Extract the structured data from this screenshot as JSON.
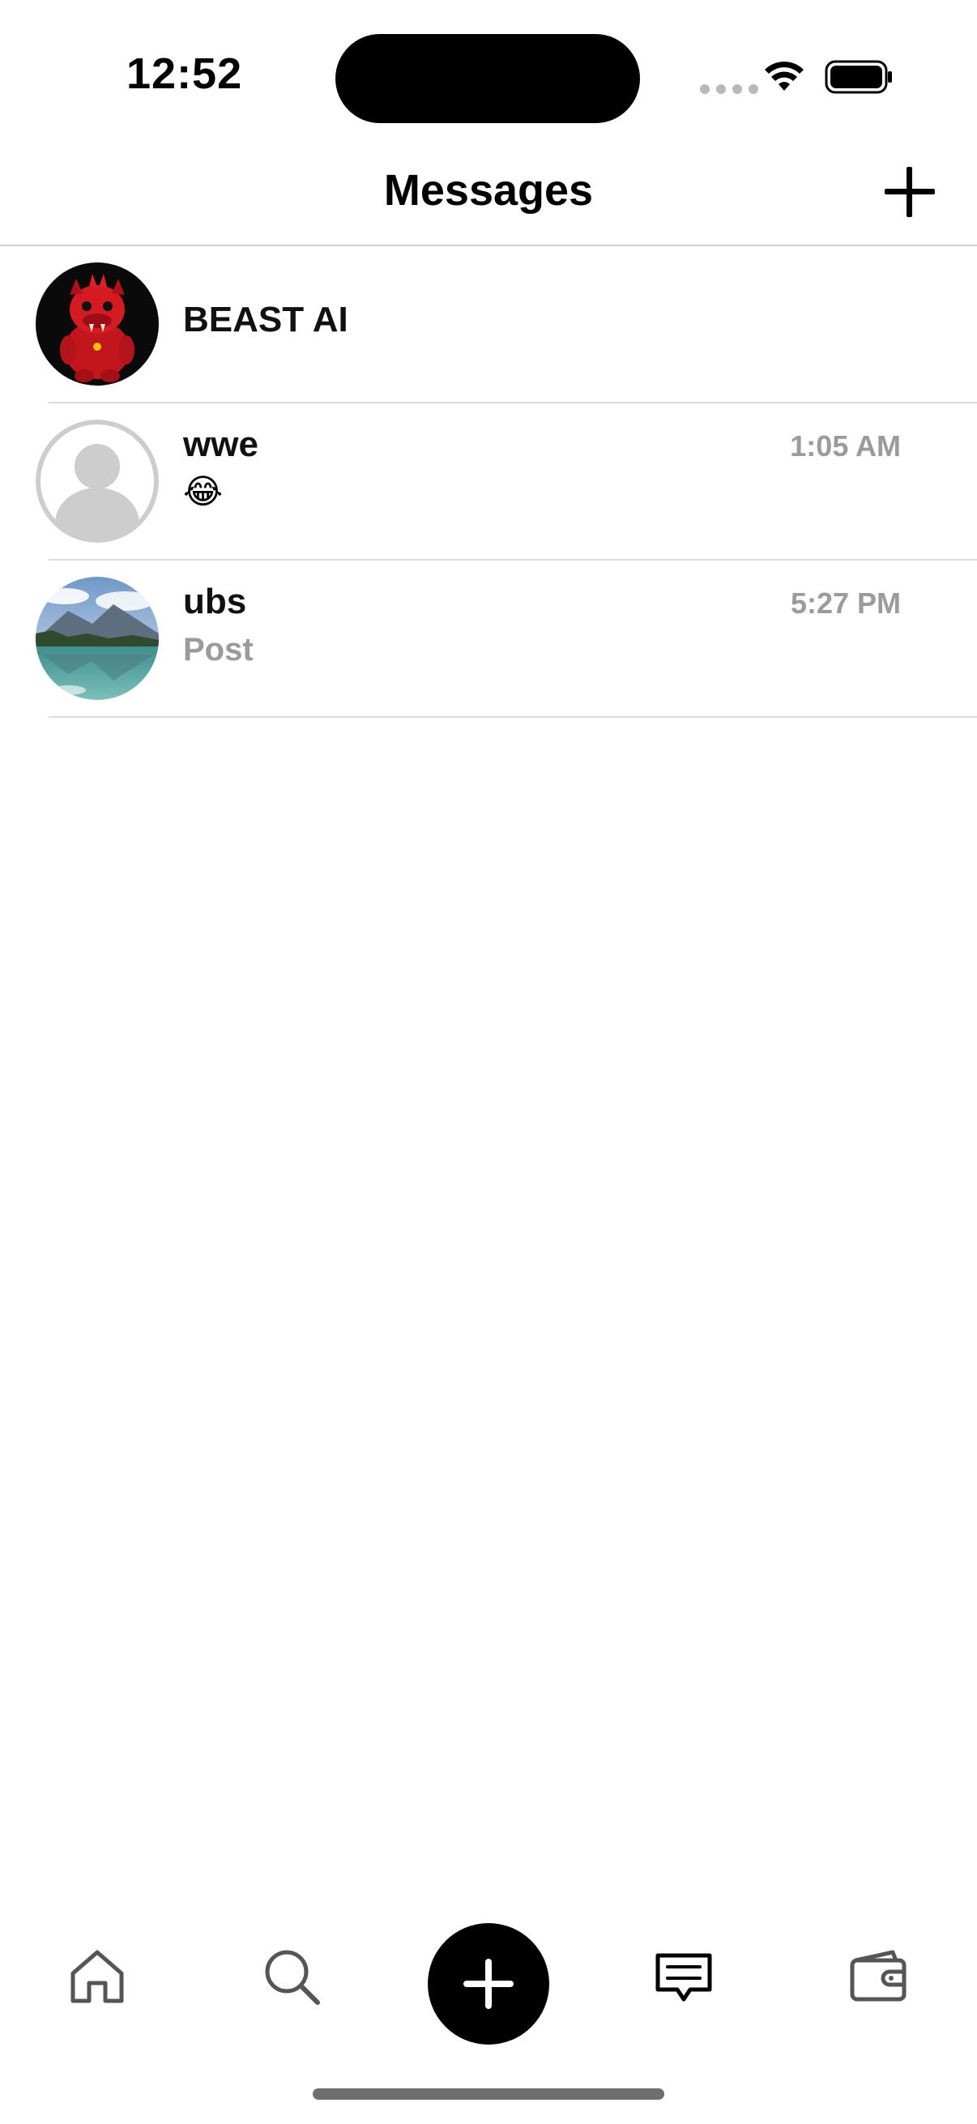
{
  "status_bar": {
    "time": "12:52",
    "icons": [
      "cellular-signal-icon",
      "wifi-icon",
      "battery-icon"
    ]
  },
  "header": {
    "title": "Messages",
    "action_icon": "plus-icon"
  },
  "conversations": [
    {
      "name": "BEAST AI",
      "preview": "",
      "time": "",
      "avatar": "red-plush-monster-photo"
    },
    {
      "name": "wwe",
      "preview": "😂",
      "time": "1:05 AM",
      "avatar": "default-person-placeholder"
    },
    {
      "name": "ubs",
      "preview": "Post",
      "time": "5:27 PM",
      "avatar": "mountain-lake-photo"
    }
  ],
  "tab_bar": {
    "items": [
      "home-icon",
      "search-icon",
      "create-plus-icon",
      "messages-icon",
      "wallet-icon"
    ],
    "active": "messages-icon"
  },
  "colors": {
    "text_primary": "#111111",
    "text_secondary": "#9b9b9b",
    "divider": "#dcdcdc",
    "accent": "#000000"
  }
}
